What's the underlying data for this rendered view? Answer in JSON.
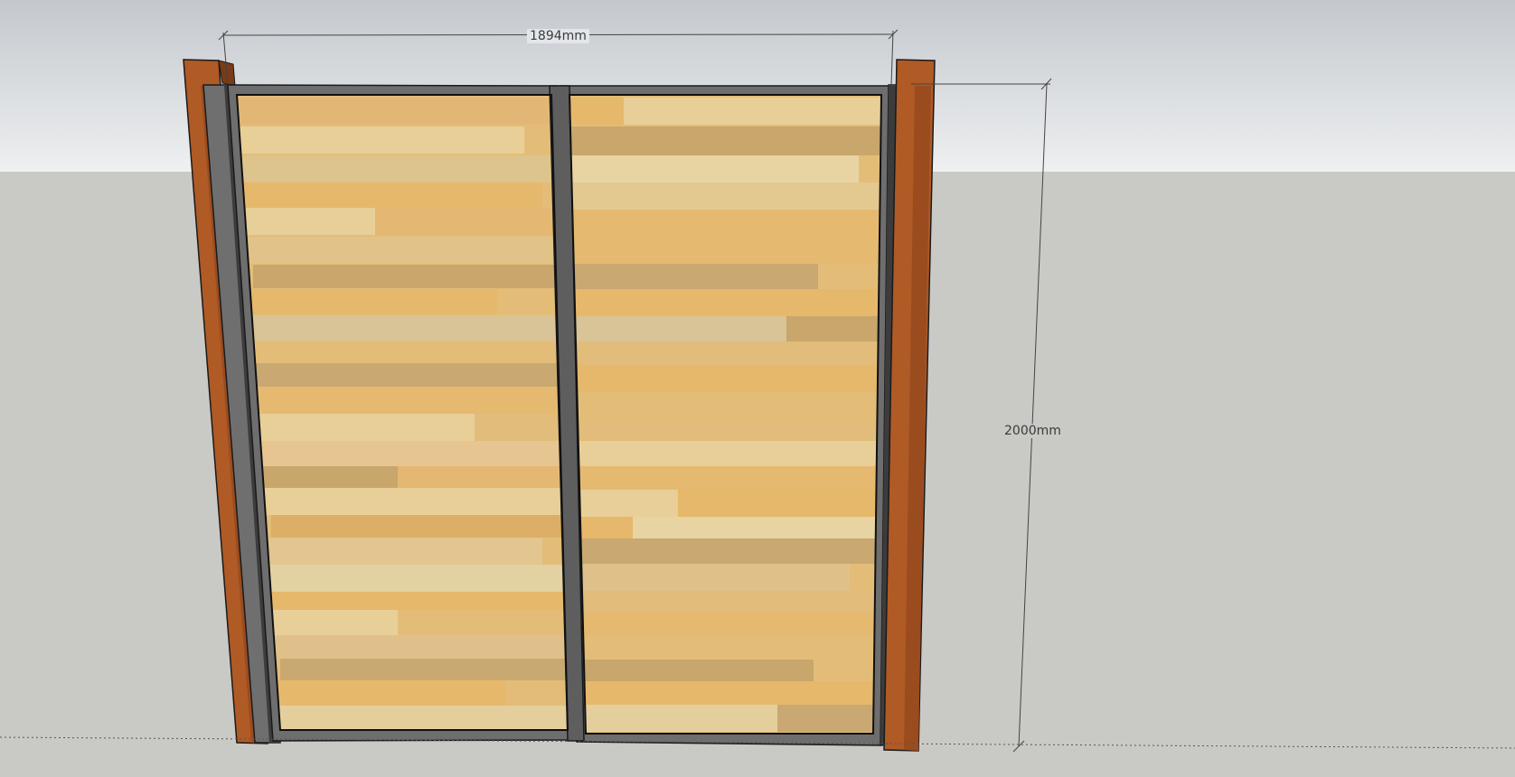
{
  "scene": {
    "sky_color_top": "#c4c8cd",
    "sky_color_bottom": "#eef0f1",
    "ground_color": "#c9cac6",
    "wood_post_color": "#b05a25",
    "steel_frame_color": "#6b6b6b",
    "panel_wood_tones": [
      "#e3bd78",
      "#d9b27a",
      "#e8cf98",
      "#c8a66c",
      "#e6b86c"
    ]
  },
  "dimensions": {
    "width_label": "1894mm",
    "height_label": "2000mm"
  }
}
